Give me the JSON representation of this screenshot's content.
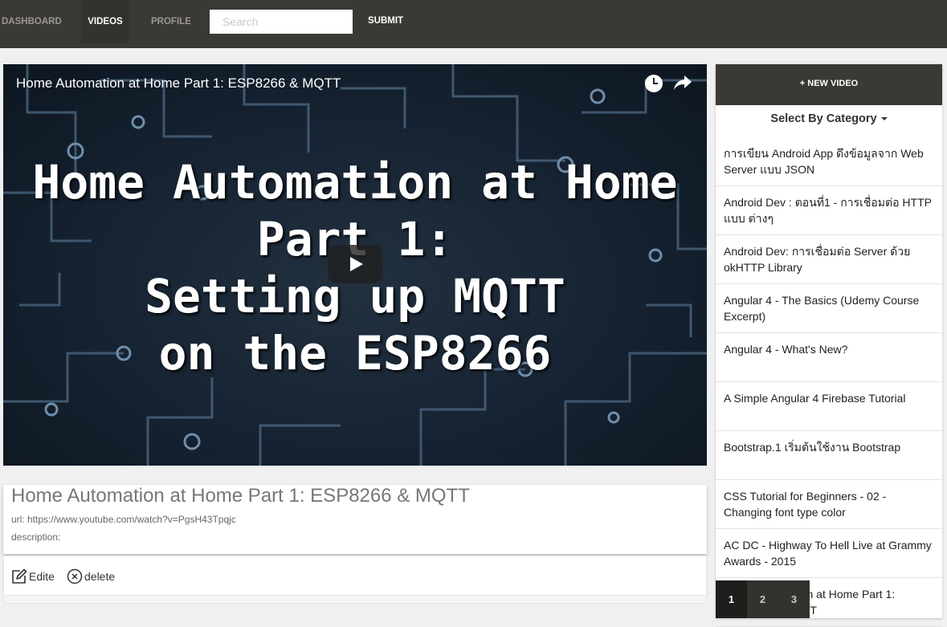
{
  "nav": {
    "items": [
      {
        "label": "DASHBOARD"
      },
      {
        "label": "VIDEOS"
      },
      {
        "label": "PROFILE"
      }
    ],
    "active": "VIDEOS",
    "search_placeholder": "Search",
    "search_value": "",
    "submit_label": "SUBMIT"
  },
  "player": {
    "title": "Home Automation at Home Part 1: ESP8266 & MQTT",
    "thumbnail_text": "Home Automation at Home\nPart 1:\nSetting up MQTT\non the ESP8266",
    "icons": [
      "clock-icon",
      "share-icon",
      "play-icon"
    ]
  },
  "details": {
    "title": "Home Automation at Home Part 1: ESP8266 & MQTT",
    "url_text": "url: https://www.youtube.com/watch?v=PgsH43Tpqjc",
    "description_text": "description:"
  },
  "actions": {
    "edit_label": "Edite",
    "delete_label": "delete"
  },
  "sidebar": {
    "new_video_label": "+ NEW VIDEO",
    "category_label": "Select By Category",
    "videos": [
      {
        "label": "การเขียน Android App ดึงข้อมูลจาก Web Server แบบ JSON"
      },
      {
        "label": "Android Dev : ตอนที่1 - การเชื่อมต่อ HTTP แบบ ต่างๆ"
      },
      {
        "label": "Android Dev: การเชื่อมต่อ Server ด้วย okHTTP Library"
      },
      {
        "label": "Angular 4 - The Basics (Udemy Course Excerpt)"
      },
      {
        "label": "Angular 4 - What's New?"
      },
      {
        "label": "A Simple Angular 4 Firebase Tutorial"
      },
      {
        "label": "Bootstrap.1 เริ่มต้นใช้งาน Bootstrap"
      },
      {
        "label": "CSS Tutorial for Beginners - 02 - Changing font type color"
      },
      {
        "label": "AC DC - Highway To Hell Live at Grammy Awards - 2015"
      },
      {
        "label": "Home Automation at Home Part 1: ESP8266 & MQTT"
      }
    ],
    "pages": [
      "1",
      "2",
      "3"
    ],
    "current_page": "1"
  },
  "colors": {
    "topbar": "#3a3935",
    "nav_active_bg": "#33322e",
    "page_active_bg": "#1e1e1c"
  }
}
